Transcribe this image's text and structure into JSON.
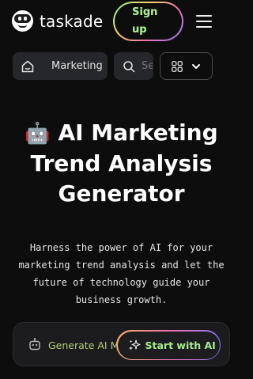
{
  "header": {
    "logo_text": "taskade",
    "signup_label": "Sign up",
    "menu_icon": "hamburger-menu-icon"
  },
  "nav": {
    "home_icon": "home-icon",
    "category_label": "Marketing",
    "search_icon": "search-icon",
    "search_placeholder": "Search",
    "apps_icon": "grid-icon",
    "apps_chevron": "chevron-down-icon"
  },
  "hero": {
    "emoji": "🤖",
    "title": "AI Marketing Trend Analysis Generator",
    "description": "Harness the power of AI for your marketing trend analysis and let the future of technology guide your business growth."
  },
  "generate": {
    "icon": "robot-icon",
    "placeholder": "Generate AI Marketing Trend Analysis",
    "button_icon": "sparkles-icon",
    "button_label": "Start with AI"
  },
  "colors": {
    "background": "#0d0d0d",
    "accent_green": "#a8ec8c",
    "nav_bg": "#26272b"
  }
}
